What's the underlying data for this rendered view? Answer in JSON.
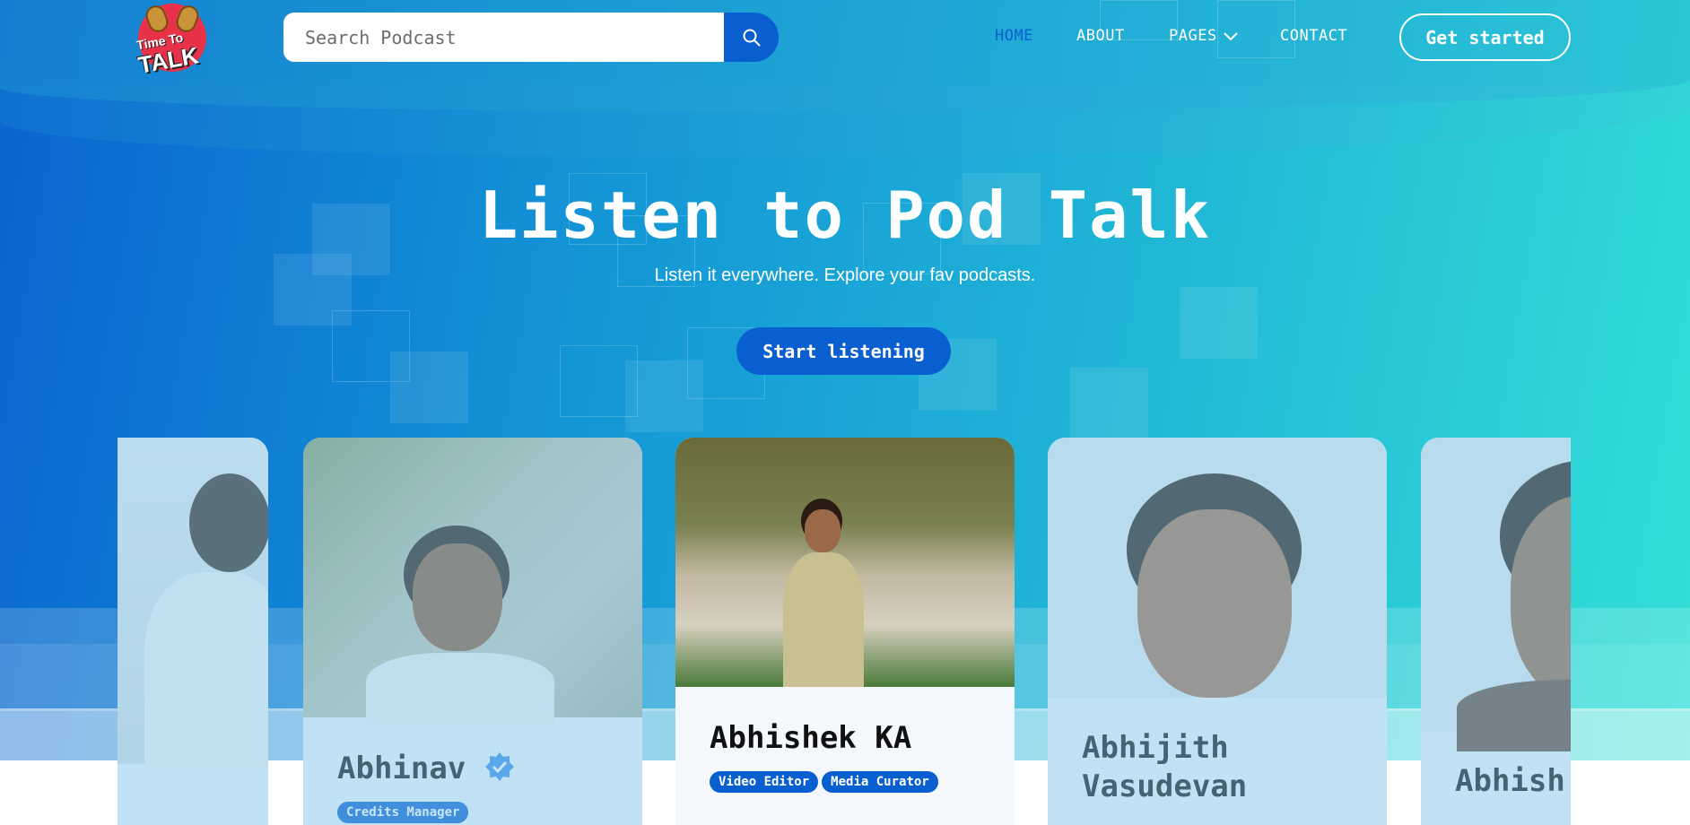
{
  "logo": {
    "line1": "Time To",
    "line2": "TALK"
  },
  "search": {
    "placeholder": "Search Podcast"
  },
  "nav": {
    "home": "HOME",
    "about": "ABOUT",
    "pages": "PAGES",
    "contact": "CONTACT",
    "cta": "Get started"
  },
  "hero": {
    "title": "Listen to Pod Talk",
    "subtitle": "Listen it everywhere. Explore your fav podcasts.",
    "button": "Start listening"
  },
  "cards": [
    {
      "name": "Abhinav",
      "tags": [
        "Credits Manager"
      ]
    },
    {
      "name": "Abhishek KA",
      "tags": [
        "Video Editor",
        "Media Curator"
      ]
    },
    {
      "name": "Abhijith Vasudevan",
      "tags": []
    },
    {
      "name": "Abhish",
      "tags": []
    }
  ],
  "colors": {
    "accent": "#0a5fd0",
    "gradient_start": "#0a63cf",
    "gradient_end": "#33e0d6"
  }
}
